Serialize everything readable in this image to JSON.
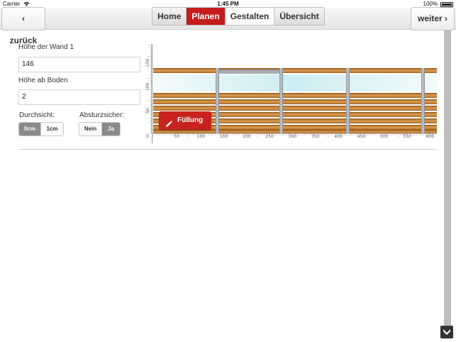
{
  "status": {
    "carrier": "Carrier",
    "time": "1:45 PM",
    "battery": "100%"
  },
  "nav": {
    "back_label": "‹ zurück",
    "next_label": "weiter ›",
    "tabs": [
      {
        "label": "Home",
        "state": "normal"
      },
      {
        "label": "Planen",
        "state": "active"
      },
      {
        "label": "Gestalten",
        "state": "current"
      },
      {
        "label": "Übersicht",
        "state": "normal"
      }
    ]
  },
  "form": {
    "wall_height_label": "Höhe der Wand 1",
    "wall_height_value": "146",
    "floor_height_label": "Höhe ab Boden",
    "floor_height_value": "2",
    "transparency_label": "Durchsicht:",
    "transparency_options": [
      "0cm",
      "1cm"
    ],
    "transparency_selected": "0cm",
    "fall_protection_label": "Absturzsicher:",
    "fall_protection_options": [
      "Nein",
      "Ja"
    ],
    "fall_protection_selected": "Ja"
  },
  "preview": {
    "fill_button_label": "Füllung",
    "x_axis_ticks": [
      "0",
      "50",
      "100",
      "150",
      "200",
      "250",
      "300",
      "350",
      "400",
      "450",
      "500",
      "550",
      "600"
    ],
    "y_axis_ticks": [
      "50",
      "100",
      "150"
    ],
    "accent_color": "#c51d1d"
  }
}
